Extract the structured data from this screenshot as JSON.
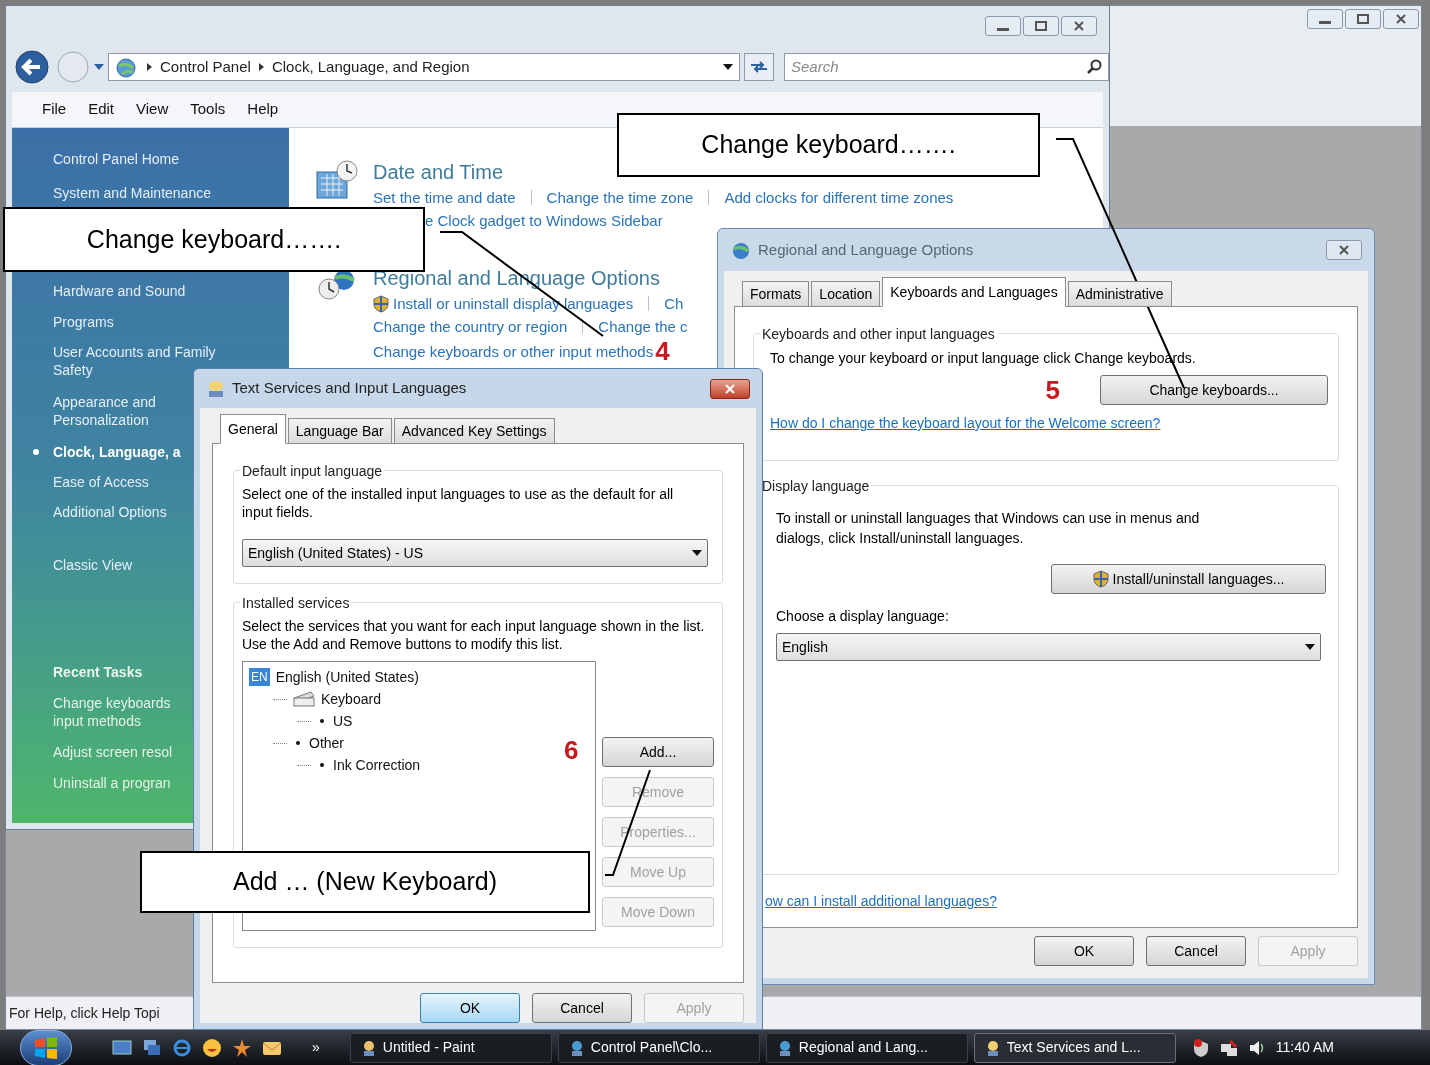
{
  "background_window": {
    "status_text": "For Help, click Help Topi"
  },
  "control_panel": {
    "breadcrumb": [
      "Control Panel",
      "Clock, Language, and Region"
    ],
    "search": {
      "placeholder": "Search"
    },
    "menu": [
      "File",
      "Edit",
      "View",
      "Tools",
      "Help"
    ],
    "sidebar": {
      "items": [
        {
          "label": "Control Panel Home",
          "selected": false
        },
        {
          "label": "System and Maintenance",
          "selected": false
        },
        {
          "label": "Hardware and Sound",
          "selected": false
        },
        {
          "label": "Programs",
          "selected": false
        },
        {
          "label": "User Accounts and Family Safety",
          "selected": false
        },
        {
          "label": "Appearance and Personalization",
          "selected": false
        },
        {
          "label": "Clock, Language, a",
          "selected": true
        },
        {
          "label": "Ease of Access",
          "selected": false
        },
        {
          "label": "Additional Options",
          "selected": false
        },
        {
          "label": "Classic View",
          "selected": false
        }
      ],
      "recent_tasks_heading": "Recent Tasks",
      "recent_tasks": [
        {
          "lines": [
            "Change keyboards",
            "input methods"
          ]
        },
        {
          "lines": [
            "Adjust screen resol"
          ]
        },
        {
          "lines": [
            "Uninstall a progran"
          ]
        }
      ]
    },
    "sections": [
      {
        "title": "Date and Time",
        "kind": "clock",
        "rows": [
          [
            {
              "text": "Set the time and date"
            },
            {
              "text": "Change the time zone"
            },
            {
              "text": "Add clocks for different time zones"
            }
          ],
          [
            {
              "text": "e Clock gadget to Windows Sidebar"
            }
          ]
        ]
      },
      {
        "title": "Regional and Language Options",
        "kind": "globe",
        "step": "4",
        "rows": [
          [
            {
              "text": "Install or uninstall display languages",
              "kind": "admin"
            },
            {
              "text": "Ch",
              "kind": "plain"
            }
          ],
          [
            {
              "text": "Change the country or region",
              "kind": "plain"
            },
            {
              "text": "Change the c",
              "kind": "plain"
            }
          ],
          [
            {
              "text": "Change keyboards or other input methods",
              "kind": "plain"
            }
          ]
        ]
      }
    ]
  },
  "regional_dialog": {
    "title": "Regional and Language Options",
    "tabs": [
      {
        "label": "Formats",
        "selected": false
      },
      {
        "label": "Location",
        "selected": false
      },
      {
        "label": "Keyboards and Languages",
        "selected": true
      },
      {
        "label": "Administrative",
        "selected": false
      }
    ],
    "keyboards_group": {
      "title": "Keyboards and other input languages",
      "text": "To change your keyboard or input language click Change keyboards.",
      "step": "5",
      "button": "Change keyboards...",
      "link": "How do I change the keyboard layout for the Welcome screen?"
    },
    "display_group": {
      "title": "Display language",
      "text": "To install or uninstall languages that Windows can use in menus and dialogs, click Install/uninstall languages.",
      "button": "Install/uninstall languages...",
      "select_label": "Choose a display language:",
      "select_value": "English"
    },
    "link": "ow can I install additional languages?",
    "buttons": [
      {
        "label": "OK",
        "disabled": false,
        "default": false
      },
      {
        "label": "Cancel",
        "disabled": false,
        "default": false
      },
      {
        "label": "Apply",
        "disabled": true,
        "default": false
      }
    ]
  },
  "text_services_dialog": {
    "title": "Text Services and Input Languages",
    "tabs": [
      {
        "label": "General",
        "selected": true
      },
      {
        "label": "Language Bar",
        "selected": false
      },
      {
        "label": "Advanced Key Settings",
        "selected": false
      }
    ],
    "default_group": {
      "title": "Default input language",
      "text": "Select one of the installed input languages to use as the default for all input fields.",
      "select_value": "English (United States) - US"
    },
    "services_group": {
      "title": "Installed services",
      "text": "Select the services that you want for each input language shown in the list. Use the Add and Remove buttons to modify this list.",
      "step": "6",
      "tree": [
        {
          "label": "English (United States)",
          "kind": "language",
          "badge": "EN",
          "children": [
            {
              "label": "Keyboard",
              "kind": "keyboard",
              "children": [
                {
                  "label": "US",
                  "kind": "bullet"
                }
              ]
            },
            {
              "label": "Other",
              "kind": "bullet",
              "children": [
                {
                  "label": "Ink Correction",
                  "kind": "bullet"
                }
              ]
            }
          ]
        }
      ],
      "side_buttons": [
        {
          "label": "Add...",
          "disabled": false
        },
        {
          "label": "Remove",
          "disabled": true
        },
        {
          "label": "Properties...",
          "disabled": true
        },
        {
          "label": "Move Up",
          "disabled": true
        },
        {
          "label": "Move Down",
          "disabled": true
        }
      ]
    },
    "buttons": [
      {
        "label": "OK",
        "disabled": false,
        "default": true
      },
      {
        "label": "Cancel",
        "disabled": false,
        "default": false
      },
      {
        "label": "Apply",
        "disabled": true,
        "default": false
      }
    ]
  },
  "callouts": [
    {
      "text": "Change keyboard……."
    },
    {
      "text": "Change keyboard……."
    },
    {
      "text": "Add … (New Keyboard)"
    }
  ],
  "taskbar": {
    "tasks": [
      {
        "label": "Untitled - Paint",
        "selected": false
      },
      {
        "label": "Control Panel\\Clo...",
        "selected": false
      },
      {
        "label": "Regional and Lang...",
        "selected": false
      },
      {
        "label": "Text Services and L...",
        "selected": true
      }
    ],
    "overflow": "»",
    "clock": "11:40 AM"
  }
}
